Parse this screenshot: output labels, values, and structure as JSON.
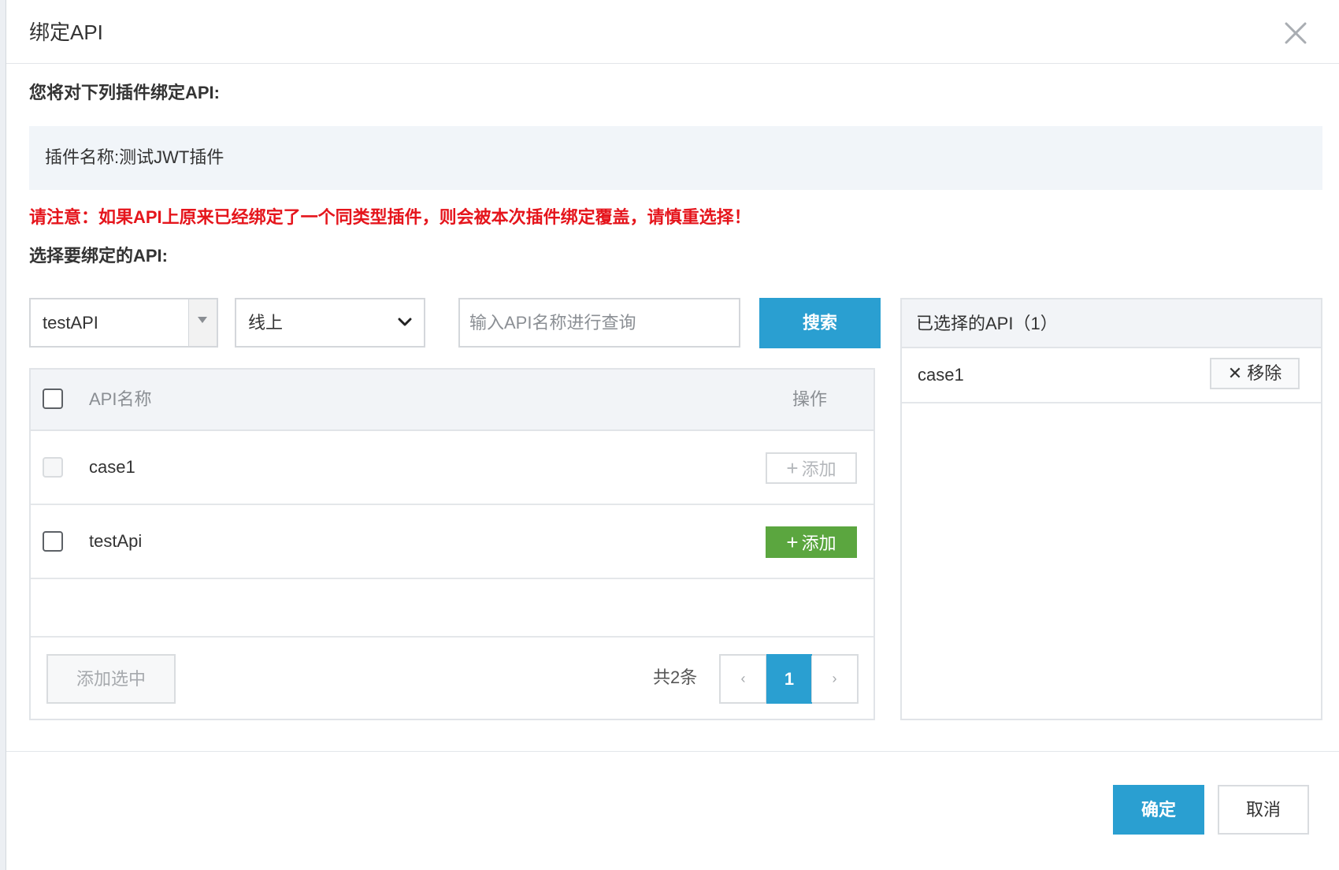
{
  "dialog": {
    "title": "绑定API",
    "close_icon": "close-icon"
  },
  "intro": {
    "heading": "您将对下列插件绑定API:",
    "plugin_label": "插件名称:",
    "plugin_name": "测试JWT插件"
  },
  "warning": "请注意：如果API上原来已经绑定了一个同类型插件，则会被本次插件绑定覆盖，请慎重选择！",
  "select_section": {
    "heading": "选择要绑定的API:",
    "group_select": {
      "value": "testAPI",
      "icon": "caret-down-icon"
    },
    "env_select": {
      "value": "线上",
      "icon": "chevron-down-icon"
    },
    "search": {
      "placeholder": "输入API名称进行查询",
      "value": ""
    },
    "search_button": "搜索"
  },
  "api_table": {
    "columns": {
      "name": "API名称",
      "operation": "操作"
    },
    "rows": [
      {
        "name": "case1",
        "action": "添加",
        "added": true
      },
      {
        "name": "testApi",
        "action": "添加",
        "added": false
      }
    ],
    "add_selected_button": "添加选中",
    "total_text": "共2条",
    "pagination": {
      "prev": "‹",
      "current": "1",
      "next": "›"
    }
  },
  "selected_panel": {
    "title": "已选择的API（1）",
    "items": [
      {
        "name": "case1",
        "remove_label": "移除"
      }
    ]
  },
  "footer": {
    "confirm": "确定",
    "cancel": "取消"
  },
  "colors": {
    "primary": "#2a9fd1",
    "success": "#5ba63f",
    "danger": "#e5151c",
    "info_bg": "#f1f5f9"
  }
}
